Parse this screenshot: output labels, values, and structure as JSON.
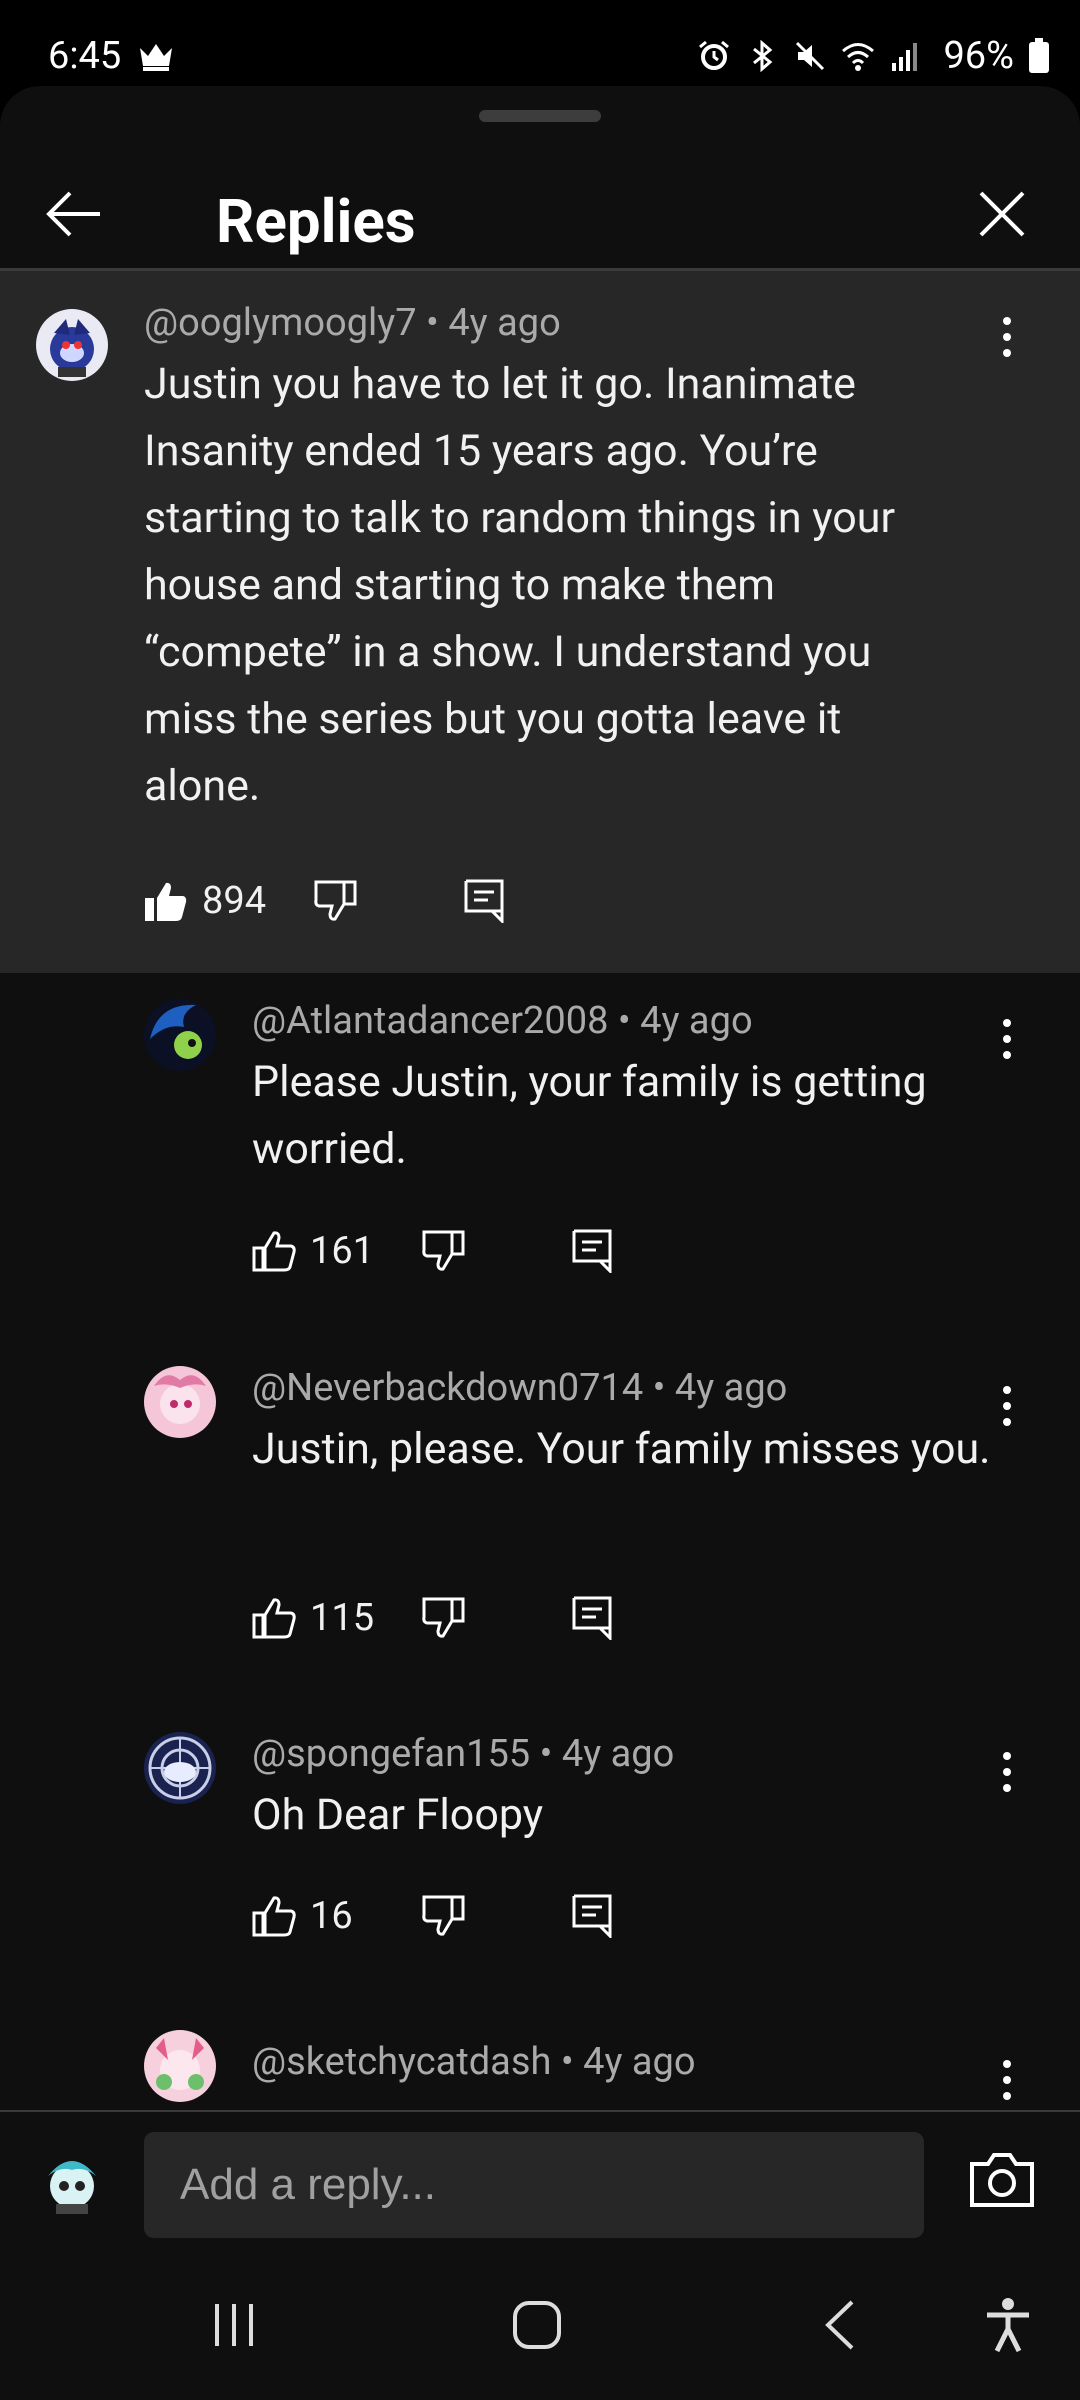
{
  "status_bar": {
    "time": "6:45",
    "battery": "96%",
    "icons": [
      "crown-icon",
      "alarm-icon",
      "bluetooth-icon",
      "mute-icon",
      "wifi-icon",
      "signal-icon",
      "battery-icon"
    ]
  },
  "header": {
    "title": "Replies",
    "back_icon": "back-arrow-icon",
    "close_icon": "close-icon"
  },
  "main_comment": {
    "author": "@ooglymoogly7",
    "time": "4y ago",
    "text": "Justin you have to let it go. Inanimate Insanity ended 15 years ago. You’re starting to talk to random things in your house and starting to make them “compete” in a show. I understand you miss the series but you gotta leave it alone.",
    "likes": "894"
  },
  "replies": [
    {
      "author": "@Atlantadancer2008",
      "time": "4y ago",
      "text": "Please Justin, your family is getting worried.",
      "likes": "161"
    },
    {
      "author": "@Neverbackdown0714",
      "time": "4y ago",
      "text": "Justin, please. Your family misses you.",
      "likes": "115"
    },
    {
      "author": "@spongefan155",
      "time": "4y ago",
      "text": "Oh Dear Floopy",
      "likes": "16"
    },
    {
      "author": "@sketchycatdash",
      "time": "4y ago"
    }
  ],
  "separator": "•",
  "composer": {
    "placeholder": "Add a reply..."
  },
  "colors": {
    "background": "#0f0f0f",
    "highlight_comment": "#272727",
    "secondary_text": "#aaaaaa",
    "primary_text": "#f1f1f1"
  }
}
